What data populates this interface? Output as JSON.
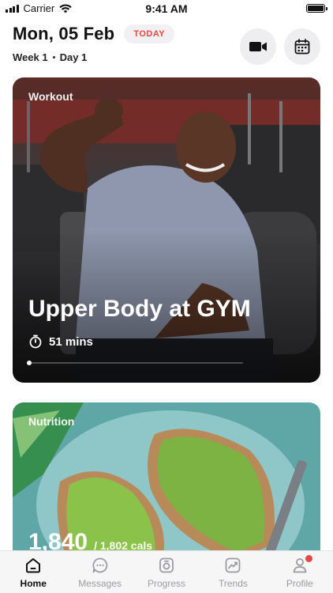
{
  "status_bar": {
    "carrier": "Carrier",
    "time": "9:41 AM"
  },
  "header": {
    "date": "Mon, 05 Feb",
    "today_label": "TODAY",
    "week": "Week 1",
    "day": "Day 1",
    "video_icon": "video-camera-icon",
    "calendar_icon": "calendar-icon"
  },
  "workout_card": {
    "label": "Workout",
    "title": "Upper Body at GYM",
    "duration": "51 mins",
    "progress": 0
  },
  "nutrition_card": {
    "label": "Nutrition",
    "calories": "1,840",
    "calories_target": "/ 1,802 cals"
  },
  "tabs": [
    {
      "label": "Home",
      "icon": "home-icon",
      "active": true
    },
    {
      "label": "Messages",
      "icon": "chat-bubble-icon",
      "active": false
    },
    {
      "label": "Progress",
      "icon": "progress-camera-icon",
      "active": false
    },
    {
      "label": "Trends",
      "icon": "trend-chart-icon",
      "active": false
    },
    {
      "label": "Profile",
      "icon": "person-icon",
      "active": false,
      "notification": true
    }
  ],
  "colors": {
    "accent": "#e5483f",
    "tab_inactive": "#9b9ba2",
    "badge_bg": "#f1f1f3"
  }
}
